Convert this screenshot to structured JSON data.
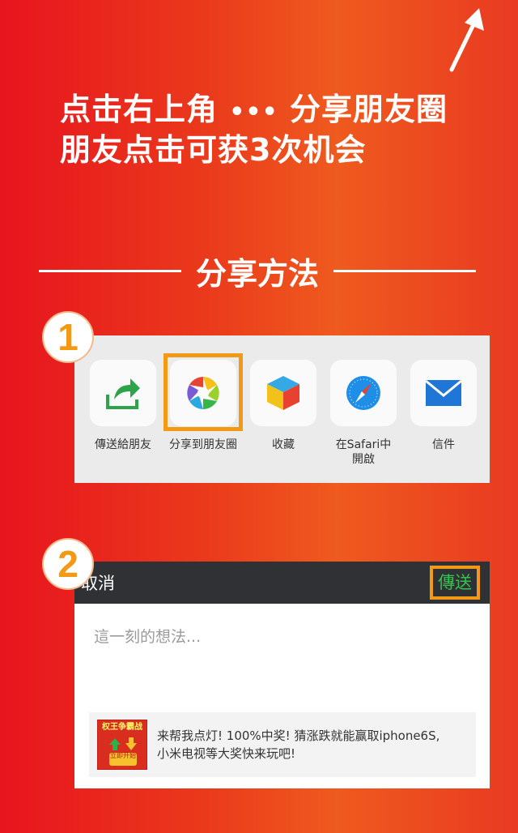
{
  "icons": {
    "corner_arrow": "arrow-up-right-icon",
    "dots": "ellipsis-icon"
  },
  "headline": {
    "line1_prefix": "点击右上角",
    "dots": "•••",
    "line1_suffix": "分享朋友圈",
    "line2": "朋友点击可获3次机会"
  },
  "section": {
    "title": "分享方法"
  },
  "step1": {
    "badge": "1",
    "items": [
      {
        "label": "傳送給朋友",
        "icon": "share-arrow-icon"
      },
      {
        "label": "分享到朋友圈",
        "icon": "moments-aperture-icon"
      },
      {
        "label": "收藏",
        "icon": "favorites-cube-icon"
      },
      {
        "label": "在Safari中\n開啟",
        "icon": "safari-compass-icon"
      },
      {
        "label": "信件",
        "icon": "mail-envelope-icon"
      }
    ]
  },
  "step2": {
    "badge": "2",
    "cancel": "取消",
    "send": "傳送",
    "placeholder": "這一刻的想法...",
    "card": {
      "thumb_title": "权王争霸战",
      "thumb_button": "立即开始",
      "line1": "来帮我点灯! 100%中奖! 猜涨跌就能赢取iphone6S,",
      "line2": "小米电视等大奖快来玩吧!"
    }
  },
  "colors": {
    "accent_orange": "#f29a16",
    "send_green": "#33c34c",
    "bar_dark": "#2f3134"
  }
}
